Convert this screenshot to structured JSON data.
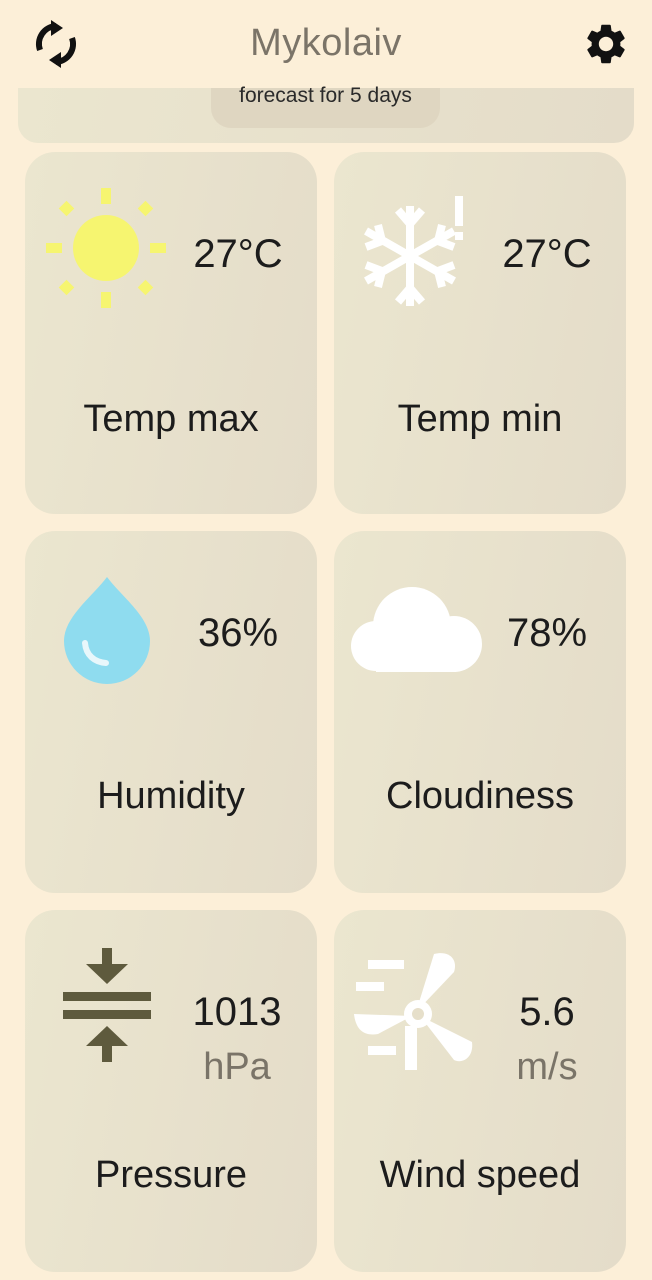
{
  "header": {
    "city": "Mykolaiv",
    "refresh_icon": "refresh-icon",
    "settings_icon": "gear-icon"
  },
  "forecast": {
    "label": "forecast for 5 days"
  },
  "cards": {
    "temp_max": {
      "value": "27°C",
      "label": "Temp max",
      "icon": "sun-icon",
      "icon_color": "#f6f570"
    },
    "temp_min": {
      "value": "27°C",
      "label": "Temp min",
      "icon": "snowflake-icon",
      "icon_color": "#ffffff"
    },
    "humidity": {
      "value": "36%",
      "label": "Humidity",
      "icon": "water-drop-icon",
      "icon_color": "#8fdcef"
    },
    "cloudiness": {
      "value": "78%",
      "label": "Cloudiness",
      "icon": "cloud-icon",
      "icon_color": "#ffffff"
    },
    "pressure": {
      "value": "1013",
      "unit": "hPa",
      "label": "Pressure",
      "icon": "pressure-icon",
      "icon_color": "#5e5a3d"
    },
    "wind_speed": {
      "value": "5.6",
      "unit": "m/s",
      "label": "Wind speed",
      "icon": "wind-turbine-icon",
      "icon_color": "#ffffff"
    }
  },
  "colors": {
    "background": "#fcefd8",
    "card": "#e8e2cd",
    "title": "#7b7468"
  }
}
